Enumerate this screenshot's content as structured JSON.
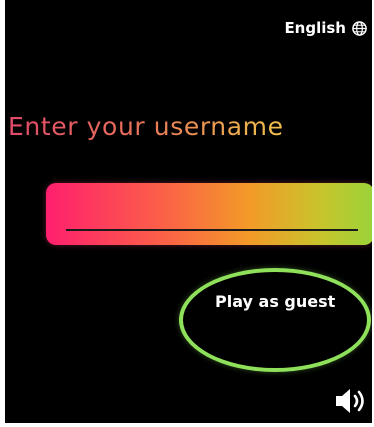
{
  "header": {
    "language_label": "English",
    "language_icon": "globe-icon"
  },
  "login": {
    "username_label": "Enter your username",
    "username_value": "",
    "username_placeholder": "",
    "input_gradient": [
      "#ff1f6e",
      "#fb5f48",
      "#f39a28",
      "#c7c52b",
      "#9bd33a"
    ],
    "guest_button_label": "Play as guest",
    "guest_ring_color": "#8fe05a"
  },
  "footer": {
    "sound_icon": "speaker-icon"
  },
  "colors": {
    "background": "#000000",
    "text": "#ffffff"
  }
}
